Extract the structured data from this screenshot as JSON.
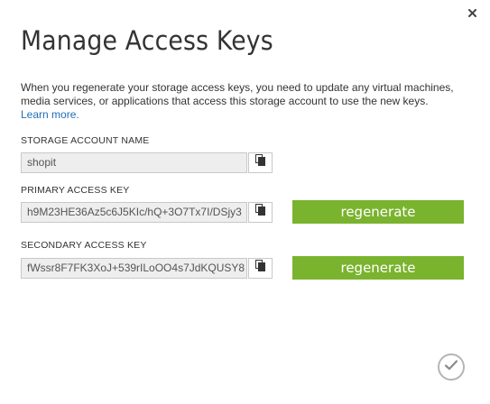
{
  "dialog": {
    "title": "Manage Access Keys",
    "description": "When you regenerate your storage access keys, you need to update any virtual machines, media services, or applications that access this storage account to use the new keys.",
    "learn_more": "Learn more."
  },
  "account": {
    "label": "STORAGE ACCOUNT NAME",
    "value": "shopit"
  },
  "primary": {
    "label": "PRIMARY ACCESS KEY",
    "value": "h9M23HE36Az5c6J5KIc/hQ+3O7Tx7I/DSjy3",
    "regenerate_label": "regenerate"
  },
  "secondary": {
    "label": "SECONDARY ACCESS KEY",
    "value": "fWssr8F7FK3XoJ+539rILoOO4s7JdKQUSY8",
    "regenerate_label": "regenerate"
  },
  "icons": {
    "close": "close-icon",
    "copy": "copy-icon",
    "confirm": "checkmark-icon"
  },
  "colors": {
    "regenerate": "#7ab32e",
    "link": "#1f6fb6"
  }
}
